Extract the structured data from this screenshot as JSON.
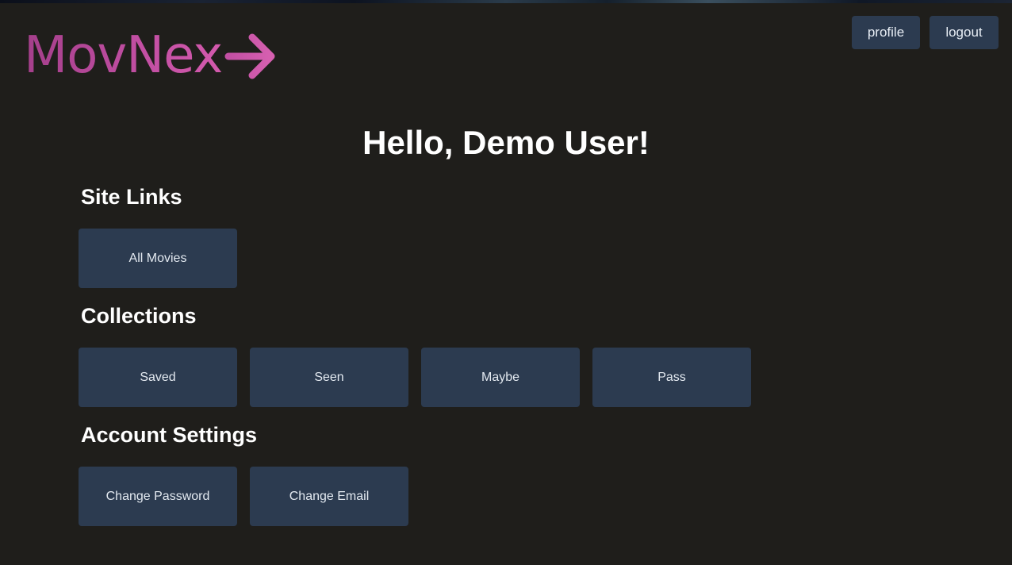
{
  "header": {
    "logo_text": "MovNex",
    "logo_gradient_start": "#a43f8b",
    "logo_gradient_end": "#d35aad",
    "profile_label": "profile",
    "logout_label": "logout",
    "button_color": "#2c3b50"
  },
  "main": {
    "greeting": "Hello, Demo User!",
    "sections": [
      {
        "title": "Site Links",
        "links": [
          "All Movies"
        ]
      },
      {
        "title": "Collections",
        "links": [
          "Saved",
          "Seen",
          "Maybe",
          "Pass"
        ]
      },
      {
        "title": "Account Settings",
        "links": [
          "Change Password",
          "Change Email"
        ]
      }
    ]
  },
  "colors": {
    "background": "#1f1e1b",
    "tile": "#2c3b50",
    "text": "#ffffff"
  }
}
